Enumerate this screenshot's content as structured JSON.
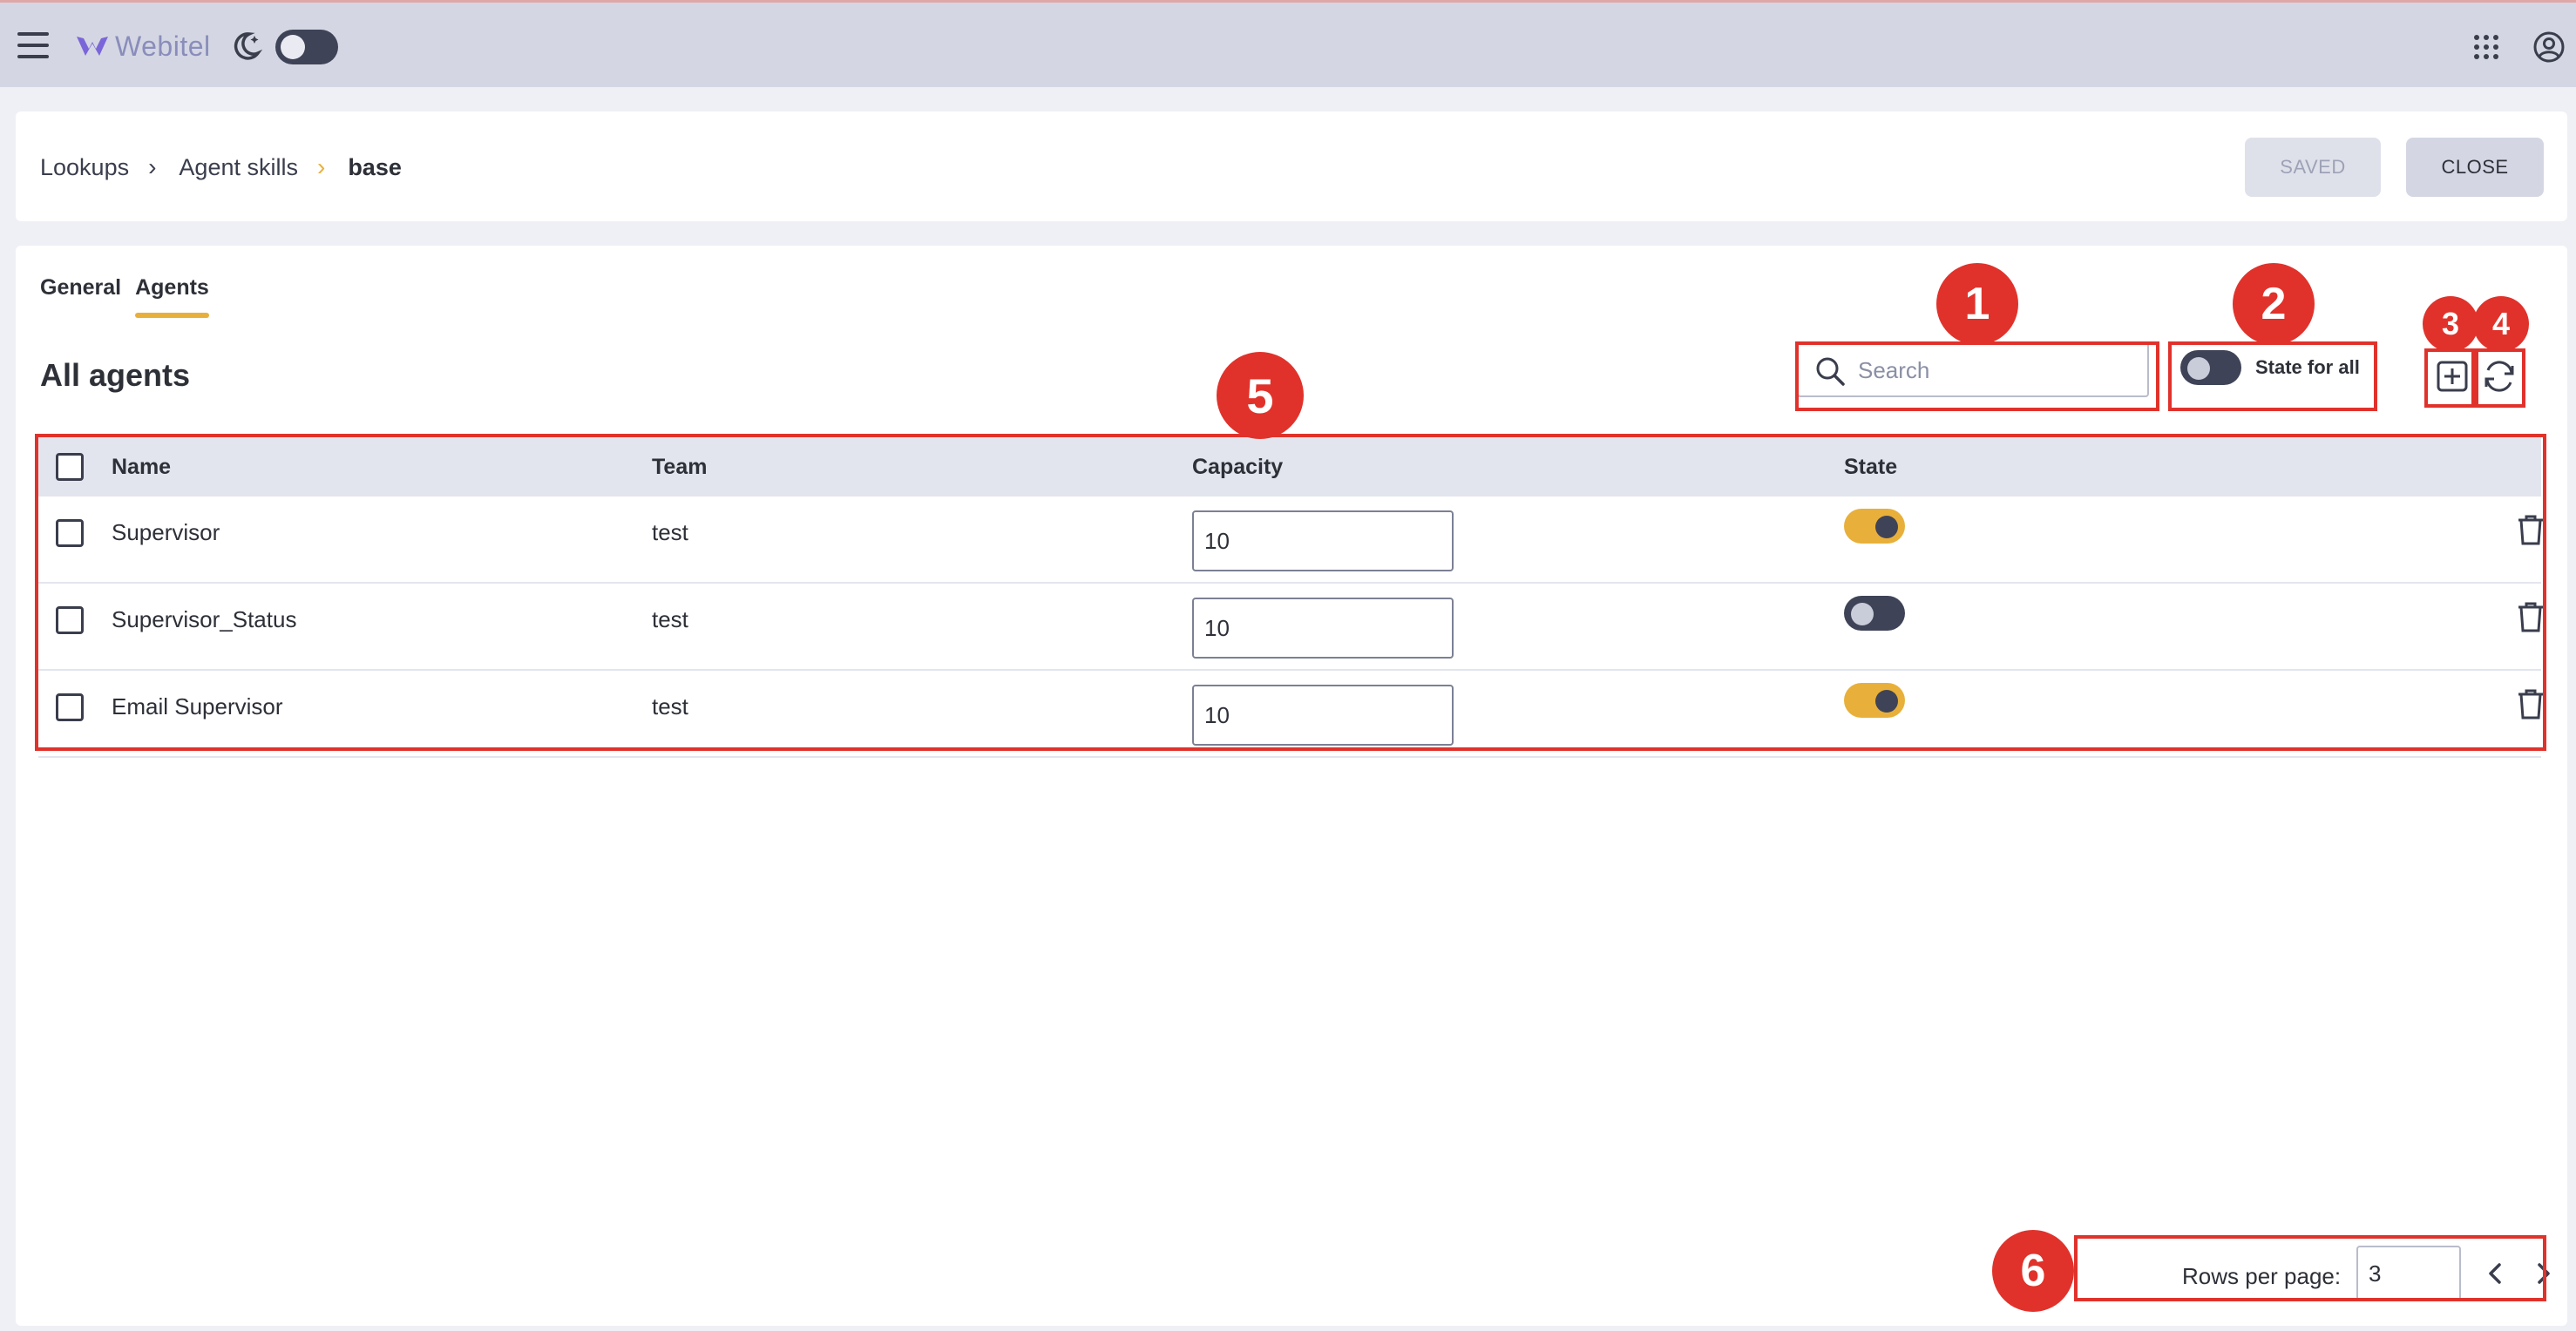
{
  "header": {
    "logo_text": "Webitel",
    "icons": [
      "menu-icon",
      "moon-icon",
      "apps-grid-icon",
      "account-icon"
    ]
  },
  "breadcrumb": {
    "items": [
      "Lookups",
      "Agent skills",
      "base"
    ],
    "separator": "›"
  },
  "actions": {
    "saved_label": "SAVED",
    "close_label": "CLOSE"
  },
  "tabs": [
    {
      "label": "General",
      "active": false
    },
    {
      "label": "Agents",
      "active": true
    }
  ],
  "section_title": "All agents",
  "search": {
    "placeholder": "Search",
    "value": ""
  },
  "state_for_all": {
    "label": "State for all",
    "on": false
  },
  "table": {
    "columns": [
      "Name",
      "Team",
      "Capacity",
      "State"
    ],
    "rows": [
      {
        "name": "Supervisor",
        "team": "test",
        "capacity": "10",
        "state": true
      },
      {
        "name": "Supervisor_Status",
        "team": "test",
        "capacity": "10",
        "state": false
      },
      {
        "name": "Email Supervisor",
        "team": "test",
        "capacity": "10",
        "state": true
      }
    ]
  },
  "pagination": {
    "rows_label": "Rows per page:",
    "rows_value": "3"
  },
  "annotations": [
    "1",
    "2",
    "3",
    "4",
    "5",
    "6"
  ],
  "colors": {
    "accent": "#e8b03a",
    "toggle_dark": "#3f4357",
    "annotation_red": "#e0322b",
    "header_bg": "#d4d7e3"
  }
}
